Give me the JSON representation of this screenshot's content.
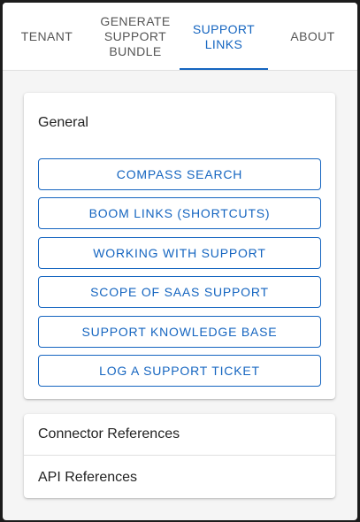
{
  "tabs": [
    {
      "label": "TENANT",
      "active": false
    },
    {
      "label": "GENERATE\nSUPPORT\nBUNDLE",
      "active": false
    },
    {
      "label": "SUPPORT\nLINKS",
      "active": true
    },
    {
      "label": "ABOUT",
      "active": false
    }
  ],
  "general": {
    "title": "General",
    "links": [
      "COMPASS SEARCH",
      "BOOM LINKS (SHORTCUTS)",
      "WORKING WITH SUPPORT",
      "SCOPE OF SAAS SUPPORT",
      "SUPPORT KNOWLEDGE BASE",
      "LOG A SUPPORT TICKET"
    ]
  },
  "references": {
    "connector": "Connector References",
    "api": "API References"
  },
  "colors": {
    "accent": "#1565c0",
    "tab_text": "#555555"
  }
}
